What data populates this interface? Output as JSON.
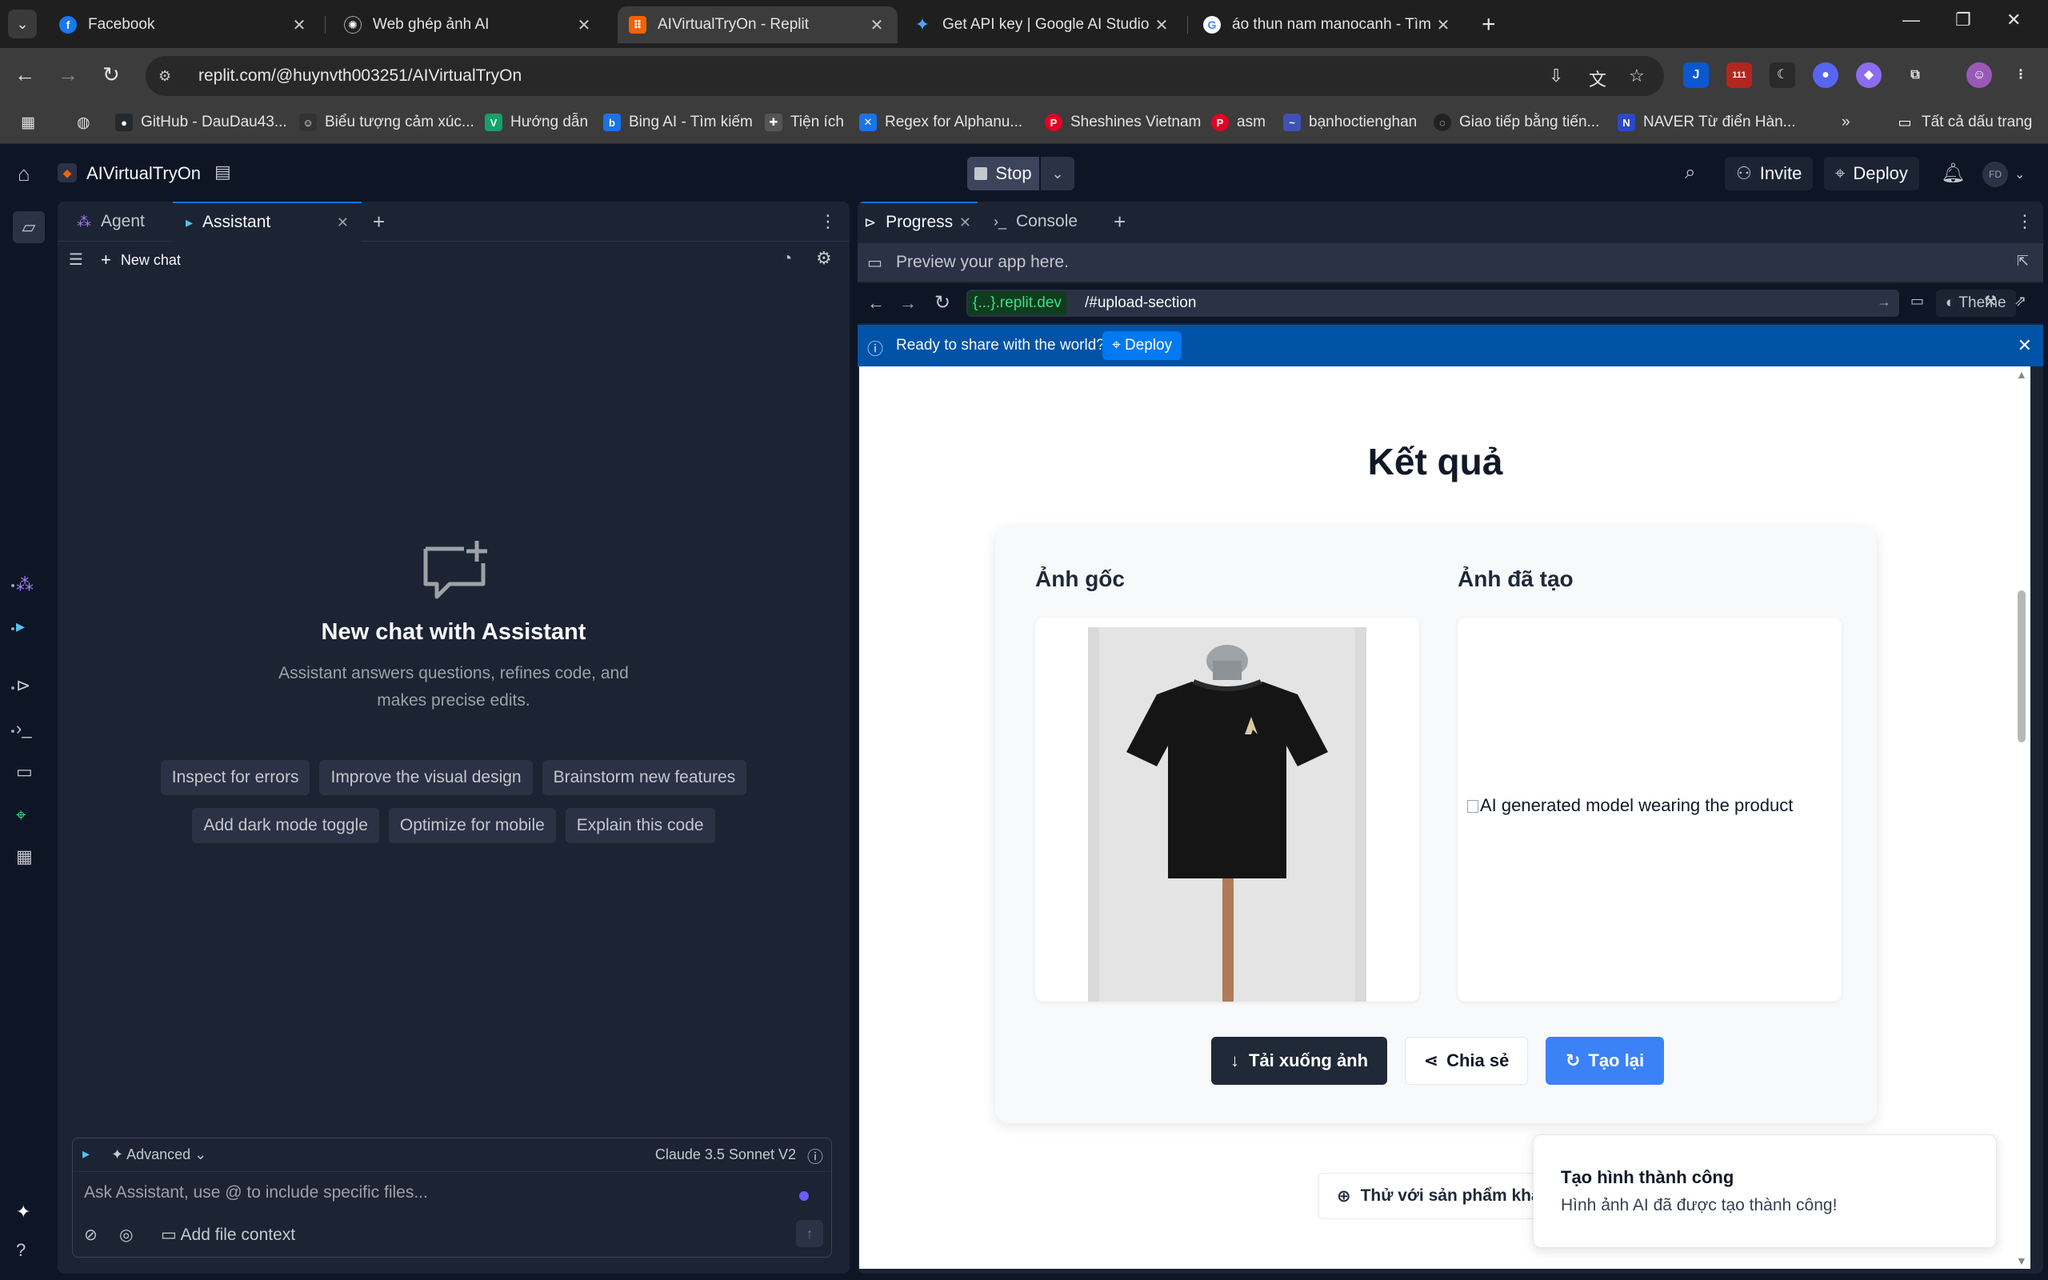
{
  "browser": {
    "tabs": [
      {
        "title": "Facebook",
        "favicon": "facebook-icon",
        "color": "#1877f2",
        "glyph": "f"
      },
      {
        "title": "Web ghép ảnh AI",
        "favicon": "chatgpt-icon",
        "color": "#1f1f1f",
        "glyph": "✺"
      },
      {
        "title": "AIVirtualTryOn - Replit",
        "favicon": "replit-icon",
        "color": "#f26207",
        "glyph": "⠿"
      },
      {
        "title": "Get API key | Google AI Studio",
        "favicon": "ai-studio-icon",
        "color": "#1f1f1f",
        "glyph": "✦"
      },
      {
        "title": "áo thun nam manocanh - Tìm t",
        "favicon": "google-icon",
        "color": "#ffffff",
        "glyph": "G"
      }
    ],
    "address": "replit.com/@huynvth003251/AIVirtualTryOn",
    "extensions": [
      {
        "name": "j-extension-icon",
        "glyph": "J",
        "color": "#0b57d0"
      },
      {
        "name": "calendar-extension-icon",
        "glyph": "111",
        "color": "#b3261e"
      },
      {
        "name": "moon-extension-icon",
        "glyph": "☾",
        "color": "#1f1f1f"
      },
      {
        "name": "discord-extension-icon",
        "glyph": "●",
        "color": "#5865f2"
      },
      {
        "name": "purple-extension-icon",
        "glyph": "◆",
        "color": "#8c6cf0"
      }
    ],
    "bookmarks": [
      {
        "label": "GitHub - DauDau43...",
        "icon": "github-icon",
        "color": "#24292e"
      },
      {
        "label": "Biểu tượng cảm xúc...",
        "icon": "emoji-icon",
        "color": "#333333"
      },
      {
        "label": "Hướng dẫn",
        "icon": "v-icon",
        "color": "#11a36a"
      },
      {
        "label": "Bing AI - Tìm kiếm",
        "icon": "bing-icon",
        "color": "#1a73e8"
      },
      {
        "label": "Tiện ích",
        "icon": "puzzle-icon",
        "color": "#555555"
      },
      {
        "label": "Regex for Alphanu...",
        "icon": "x-icon",
        "color": "#1a73e8"
      },
      {
        "label": "Sheshines Vietnam",
        "icon": "pinterest-icon",
        "color": "#e60023"
      },
      {
        "label": "asm",
        "icon": "pinterest-icon",
        "color": "#e60023"
      },
      {
        "label": "bạnhoctienghan",
        "icon": "wave-icon",
        "color": "#3f51b5"
      },
      {
        "label": "Giao tiếp bằng tiến...",
        "icon": "circle-icon",
        "color": "#222222"
      },
      {
        "label": "NAVER Từ điển Hàn...",
        "icon": "naver-icon",
        "color": "#2c48c5"
      }
    ],
    "all_bookmarks": "Tất cả dấu trang"
  },
  "replit": {
    "project_name": "AIVirtualTryOn",
    "stop_label": "Stop",
    "invite_label": "Invite",
    "deploy_label": "Deploy",
    "avatar_initials": "FD"
  },
  "left_pane": {
    "tabs": [
      {
        "label": "Agent",
        "icon": "agent-icon"
      },
      {
        "label": "Assistant",
        "icon": "assistant-icon"
      }
    ],
    "new_chat_label": "New chat",
    "empty_title": "New chat with Assistant",
    "empty_desc": "Assistant answers questions, refines code, and makes precise edits.",
    "suggestions_row1": [
      "Inspect for errors",
      "Improve the visual design",
      "Brainstorm new features"
    ],
    "suggestions_row2": [
      "Add dark mode toggle",
      "Optimize for mobile",
      "Explain this code"
    ],
    "composer": {
      "mode": "Advanced",
      "model": "Claude 3.5 Sonnet V2",
      "placeholder": "Ask Assistant, use @ to include specific files...",
      "add_context": "Add file context"
    }
  },
  "right_pane": {
    "tabs": [
      {
        "label": "Progress",
        "icon": "progress-icon"
      },
      {
        "label": "Console",
        "icon": "console-icon"
      }
    ],
    "preview_hint": "Preview your app here.",
    "url_domain": "{...}.replit.dev",
    "url_path": "/#upload-section",
    "theme_label": "Theme",
    "banner_text": "Ready to share with the world?",
    "banner_deploy": "Deploy"
  },
  "webapp": {
    "heading": "Kết quả",
    "original_label": "Ảnh gốc",
    "generated_label": "Ảnh đã tạo",
    "generated_alt": "AI generated model wearing the product",
    "download_label": "Tải xuống ảnh",
    "share_label": "Chia sẻ",
    "regenerate_label": "Tạo lại",
    "try_other_label": "Thử với sản phẩm khá",
    "toast_title": "Tạo hình thành công",
    "toast_body": "Hình ảnh AI đã được tạo thành công!"
  }
}
